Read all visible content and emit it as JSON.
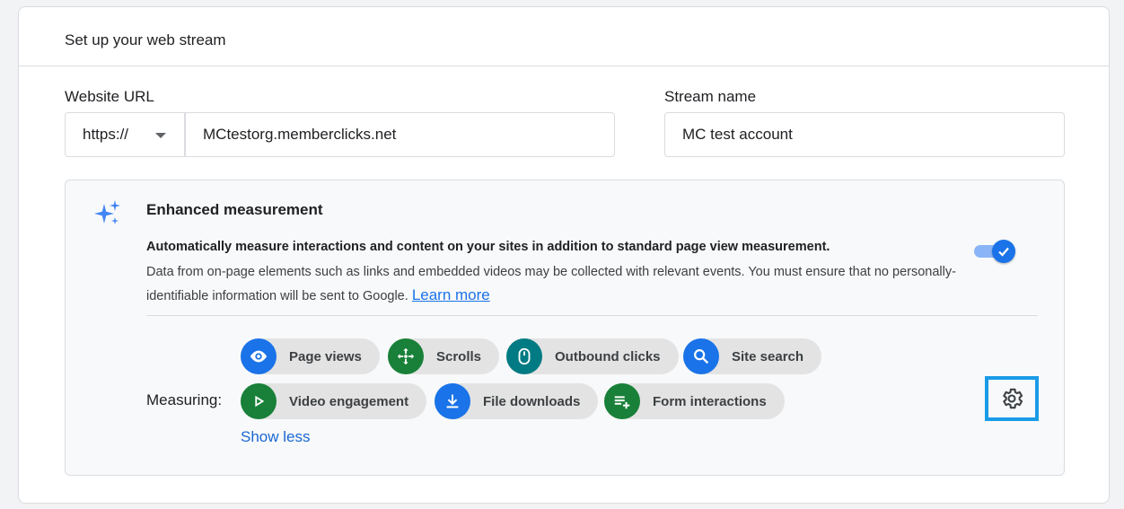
{
  "header": {
    "title": "Set up your web stream"
  },
  "website_url": {
    "label": "Website URL",
    "protocol": "https://",
    "value": "MCtestorg.memberclicks.net"
  },
  "stream_name": {
    "label": "Stream name",
    "value": "MC test account"
  },
  "enhanced_measurement": {
    "icon": "sparkle-icon",
    "title": "Enhanced measurement",
    "description_bold": "Automatically measure interactions and content on your sites in addition to standard page view measurement.",
    "description": "Data from on-page elements such as links and embedded videos may be collected with relevant events. You must ensure that no personally-identifiable information will be sent to Google.",
    "learn_more": "Learn more",
    "toggle_on": true,
    "measuring_label": "Measuring:",
    "chips": [
      {
        "label": "Page views",
        "icon": "eye-icon",
        "color": "#1a73e8"
      },
      {
        "label": "Scrolls",
        "icon": "move-arrows-icon",
        "color": "#188038"
      },
      {
        "label": "Outbound clicks",
        "icon": "mouse-icon",
        "color": "#007b83"
      },
      {
        "label": "Site search",
        "icon": "search-icon",
        "color": "#1a73e8"
      },
      {
        "label": "Video engagement",
        "icon": "play-icon",
        "color": "#188038"
      },
      {
        "label": "File downloads",
        "icon": "download-icon",
        "color": "#1a73e8"
      },
      {
        "label": "Form interactions",
        "icon": "playlist-add-icon",
        "color": "#188038"
      }
    ],
    "show_less": "Show less",
    "settings_icon": "gear-icon"
  }
}
